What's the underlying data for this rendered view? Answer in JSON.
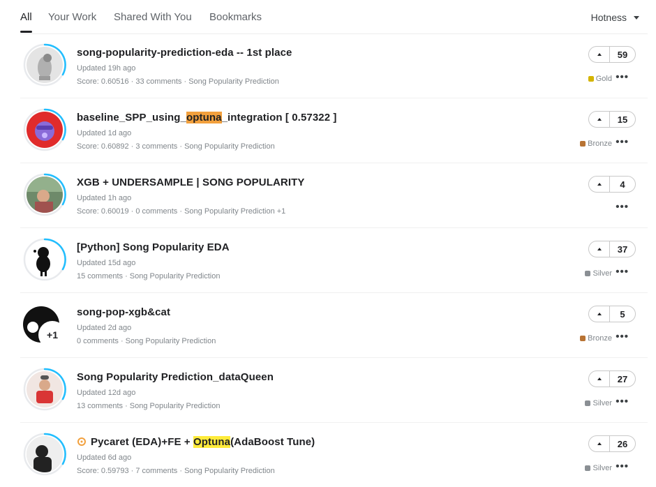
{
  "tabs": [
    {
      "label": "All",
      "active": true
    },
    {
      "label": "Your Work"
    },
    {
      "label": "Shared With You"
    },
    {
      "label": "Bookmarks"
    }
  ],
  "sort": {
    "label": "Hotness",
    "icon": "chevron-down-icon"
  },
  "items": [
    {
      "title": "song-popularity-prediction-eda -- 1st place",
      "updated": "Updated 19h ago",
      "meta": "Score: 0.60516 · 33 comments · Song Popularity Prediction",
      "votes": "59",
      "medal": "Gold",
      "medal_color": "#d4b400",
      "ring_fraction": 0.45
    },
    {
      "title_before": "baseline_SPP_using_",
      "title_highlight": "optuna",
      "title_after": "_integration [ 0.57322 ]",
      "updated": "Updated 1d ago",
      "meta": "Score: 0.60892 · 3 comments · Song Popularity Prediction",
      "votes": "15",
      "medal": "Bronze",
      "medal_color": "#b87333",
      "ring_fraction": 0.45
    },
    {
      "title": "XGB + UNDERSAMPLE | SONG POPULARITY",
      "updated": "Updated 1h ago",
      "meta": "Score: 0.60019 · 0 comments · Song Popularity Prediction +1",
      "votes": "4",
      "ring_fraction": 0.45
    },
    {
      "title": "[Python] Song Popularity EDA",
      "updated": "Updated 15d ago",
      "meta": "15 comments · Song Popularity Prediction",
      "votes": "37",
      "medal": "Silver",
      "medal_color": "#8a8f94",
      "ring_fraction": 0.45
    },
    {
      "title": "song-pop-xgb&cat",
      "updated": "Updated 2d ago",
      "meta": "0 comments · Song Popularity Prediction",
      "votes": "5",
      "medal": "Bronze",
      "medal_color": "#b87333",
      "avatar_badge": "+1"
    },
    {
      "title": "Song Popularity Prediction_dataQueen",
      "updated": "Updated 12d ago",
      "meta": "13 comments · Song Popularity Prediction",
      "votes": "27",
      "medal": "Silver",
      "medal_color": "#8a8f94",
      "ring_fraction": 0.45
    },
    {
      "title_prefix": "Pycaret (EDA)+FE + ",
      "title_highlight": "Optuna",
      "title_after": "(AdaBoost Tune)",
      "updated": "Updated 6d ago",
      "meta": "Score: 0.59793 · 7 comments · Song Popularity Prediction",
      "votes": "26",
      "medal": "Silver",
      "medal_color": "#8a8f94",
      "ring_fraction": 0.45
    }
  ],
  "colors": {
    "ring": "#20beff",
    "accent_orange": "#f2a03d",
    "accent_yellow": "#ffeb3b"
  }
}
